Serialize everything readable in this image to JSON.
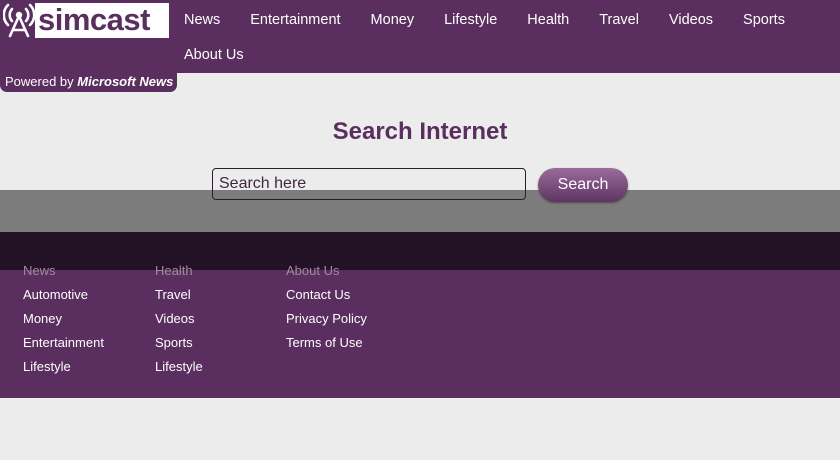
{
  "brand": {
    "name": "simcast",
    "logo_icon": "radio-tower-icon"
  },
  "nav": {
    "items": [
      "News",
      "Entertainment",
      "Money",
      "Lifestyle",
      "Health",
      "Travel",
      "Videos",
      "Sports",
      "About Us"
    ]
  },
  "powered": {
    "prefix": "Powered by",
    "provider": "Microsoft News"
  },
  "search": {
    "title": "Search Internet",
    "placeholder": "Search here",
    "button_label": "Search"
  },
  "footer": {
    "columns": [
      {
        "heading": "News",
        "links": [
          "Automotive",
          "Money",
          "Entertainment",
          "Lifestyle"
        ]
      },
      {
        "heading": "Health",
        "links": [
          "Travel",
          "Videos",
          "Sports",
          "Lifestyle"
        ]
      },
      {
        "heading": "About Us",
        "links": [
          "Contact Us",
          "Privacy Policy",
          "Terms of Use"
        ]
      }
    ]
  },
  "colors": {
    "brand": "#5a2e5e",
    "footer_dark": "#231226",
    "band_grey": "#7c7c7c",
    "page_bg": "#ececec"
  }
}
